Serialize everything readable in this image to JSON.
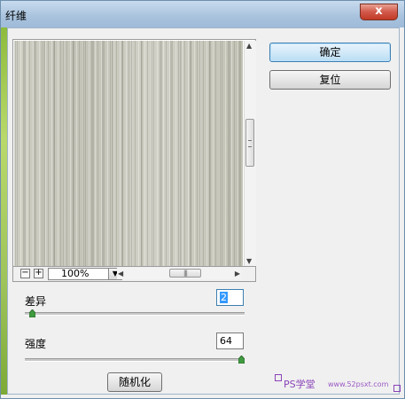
{
  "window": {
    "title": "纤维",
    "close_glyph": "x"
  },
  "buttons": {
    "ok": "确定",
    "reset": "复位",
    "randomize": "随机化"
  },
  "preview": {
    "zoom_out": "−",
    "zoom_in": "+",
    "zoom_level": "100%",
    "zoom_arrow": "▼",
    "grip": "|||"
  },
  "sliders": {
    "variance": {
      "label": "差异",
      "value": "2",
      "fraction": 0.02
    },
    "strength": {
      "label": "强度",
      "value": "64",
      "fraction": 1.0
    }
  },
  "watermark": {
    "brand": "PS学堂",
    "url": "www.52psxt.com"
  },
  "colors": {
    "accent": "#3c7fb1",
    "title_bar": "#a8c2dd",
    "close_button": "#c23a26",
    "dialog_bg": "#f0f0f0",
    "watermark": "#8a44b8"
  }
}
